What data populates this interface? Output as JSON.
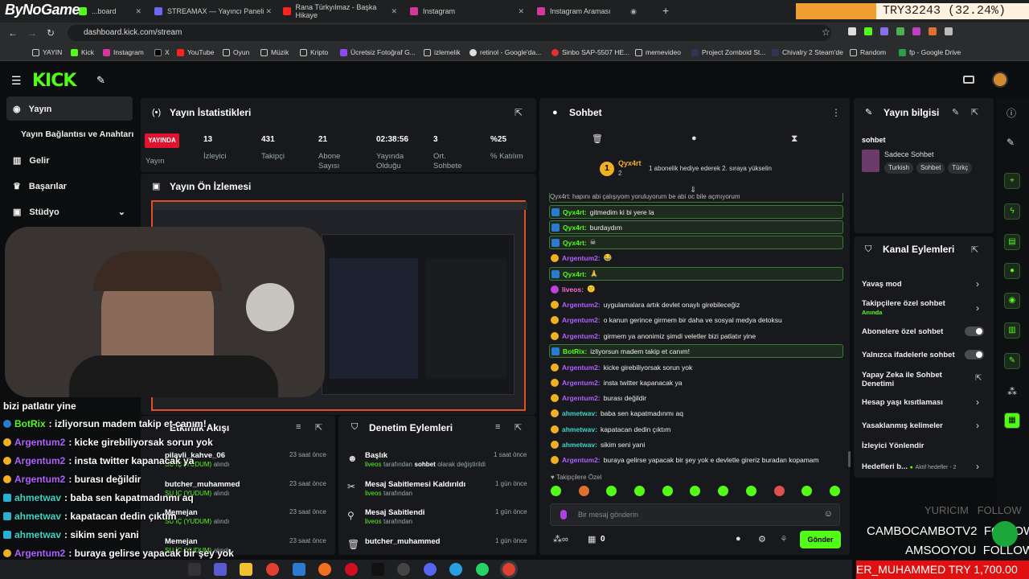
{
  "browser": {
    "tabs": [
      {
        "title": "...board",
        "x": 0
      },
      {
        "title": "STREAMAX — Yayıncı Paneli"
      },
      {
        "title": "Rana Türkyılmaz - Başka Hikaye"
      },
      {
        "title": "Instagram"
      },
      {
        "title": "Instagram Araması"
      }
    ],
    "url": "dashboard.kick.com/stream",
    "bookmarks": [
      "YAYIN",
      "Kick",
      "Instagram",
      "X",
      "YouTube",
      "Oyun",
      "Müzik",
      "Kripto",
      "Ücretsiz Fotoğraf G...",
      "izlemelik",
      "retinol - Google'da...",
      "Sinbo SAP-5507 HE...",
      "memevideo",
      "Project Zomboid St...",
      "Chivalry 2 Steam'de",
      "Random",
      "fp - Google Drive"
    ]
  },
  "overlay": {
    "brand": "ByNoGame",
    "ticker_top": "TRY32243 (32.24%)",
    "ticker_bottom": "ER_MUHAMMED  TRY 1,700.00",
    "followers": [
      {
        "name": "YURICIM",
        "label": "FOLLOW"
      },
      {
        "name": "CAMBOCAMBOTV2",
        "label": "FOLLOW"
      },
      {
        "name": "AMSOOYOU",
        "label": "FOLLOW"
      }
    ],
    "chat": [
      {
        "user": "",
        "text": "bizi patlatır yine"
      },
      {
        "user": "BotRix",
        "text": ": izliyorsun madem takip et canım!",
        "color": "#53fc18"
      },
      {
        "user": "Argentum2",
        "text": ": kicke girebiliyorsak sorun yok",
        "color": "#b060ff"
      },
      {
        "user": "Argentum2",
        "text": ": insta twitter kapanacak ya",
        "color": "#b060ff"
      },
      {
        "user": "Argentum2",
        "text": ": burası değildir",
        "color": "#b060ff"
      },
      {
        "user": "ahmetwav",
        "text": ": baba sen kapatmadınmı aq",
        "color": "#3ad6c6"
      },
      {
        "user": "ahmetwav",
        "text": ": kapatacan dedin çıktım",
        "color": "#3ad6c6"
      },
      {
        "user": "ahmetwav",
        "text": ": sikim seni yani",
        "color": "#3ad6c6"
      },
      {
        "user": "Argentum2",
        "text": ": buraya gelirse yapacak bir şey yok",
        "color": "#b060ff"
      },
      {
        "user": "",
        "text": "e devletle gireriz buradan kopamam"
      }
    ]
  },
  "sidebar": {
    "items": [
      {
        "label": "Yayın",
        "icon": "broadcast-icon"
      },
      {
        "label": "Yayın Bağlantısı ve Anahtarı",
        "icon": ""
      },
      {
        "label": "Gelir",
        "icon": "chart-icon"
      },
      {
        "label": "Başarılar",
        "icon": "trophy-icon"
      },
      {
        "label": "Stüdyo",
        "icon": "studio-icon"
      }
    ]
  },
  "stats": {
    "title": "Yayın İstatistikleri",
    "live": "YAYINDA",
    "live_sub": "Yayın",
    "items": [
      {
        "value": "13",
        "label": "İzleyici"
      },
      {
        "value": "431",
        "label": "Takipçi"
      },
      {
        "value": "21",
        "label": "Abone Sayısı"
      },
      {
        "value": "02:38:56",
        "label": "Yayında Olduğu"
      },
      {
        "value": "3",
        "label": "Ort. Sohbete"
      },
      {
        "value": "%25",
        "label": "% Katılım"
      }
    ]
  },
  "preview": {
    "title": "Yayın Ön İzlemesi"
  },
  "activity": {
    "title": "Etkinlik Akışı",
    "items": [
      {
        "name": "pilavli_kahve_06",
        "sub": "SU İÇ (YUDUM)",
        "sub2": "alındı",
        "time": "23 saat önce"
      },
      {
        "name": "butcher_muhammed",
        "sub": "SU İÇ (YUDUM)",
        "sub2": "alındı",
        "time": "23 saat önce"
      },
      {
        "name": "Memejan",
        "sub": "SU İÇ (YUDUM)",
        "sub2": "alındı",
        "time": "23 saat önce"
      },
      {
        "name": "Memejan",
        "sub": "SU İÇ (YUDUM)",
        "sub2": "alındı",
        "time": "23 saat önce"
      }
    ]
  },
  "moderation": {
    "title": "Denetim Eylemleri",
    "items": [
      {
        "title": "Başlık",
        "who": "liveos",
        "desc1": "tarafından",
        "desc2": "sohbet",
        "desc3": "olarak değiştirildi",
        "time": "1 saat önce"
      },
      {
        "title": "Mesaj Sabitlemesi Kaldırıldı",
        "who": "liveos",
        "desc1": "tarafından",
        "desc2": "",
        "desc3": "",
        "time": "1 gün önce"
      },
      {
        "title": "Mesaj Sabitlendi",
        "who": "liveos",
        "desc1": "tarafından",
        "desc2": "",
        "desc3": "",
        "time": "1 gün önce"
      },
      {
        "title": "butcher_muhammed",
        "who": "",
        "desc1": "",
        "desc2": "",
        "desc3": "",
        "time": "1 gün önce"
      }
    ]
  },
  "chat": {
    "title": "Sohbet",
    "gifter_name": "Qyx4rt",
    "gifter_count": "2",
    "gift_text": "1 abonelik hediye ederek 2. sıraya yükselin",
    "top_cut": "Qyx4rt: hapını abi çalışıyom yoruluyorum be abi oc bile açmıyorum",
    "messages": [
      {
        "user": "Qyx4rt:",
        "text": "gitmedim ki bi yere la",
        "color": "#53fc18",
        "hl": true
      },
      {
        "user": "Qyx4rt:",
        "text": "burdaydım",
        "color": "#53fc18",
        "hl": true
      },
      {
        "user": "Qyx4rt:",
        "text": "☠",
        "color": "#53fc18",
        "hl": true
      },
      {
        "user": "Argentum2:",
        "text": "😂",
        "color": "#b060ff",
        "hl": false
      },
      {
        "user": "Qyx4rt:",
        "text": "🙏",
        "color": "#53fc18",
        "hl": true
      },
      {
        "user": "liveos:",
        "text": "🙂",
        "color": "#ff6ad5",
        "hl": false
      },
      {
        "user": "Argentum2:",
        "text": "uygulamalara artık devlet onaylı girebileceğiz",
        "color": "#b060ff",
        "hl": false
      },
      {
        "user": "Argentum2:",
        "text": "o kanun gerince girmem bir daha ve sosyal medya detoksu",
        "color": "#b060ff",
        "hl": false
      },
      {
        "user": "Argentum2:",
        "text": "girmem ya anonimiz şimdi veletler bizi patlatır yine",
        "color": "#b060ff",
        "hl": false
      },
      {
        "user": "BotRix:",
        "text": "izliyorsun madem takip et canım!",
        "color": "#53fc18",
        "hl": true
      },
      {
        "user": "Argentum2:",
        "text": "kicke girebiliyorsak sorun yok",
        "color": "#b060ff",
        "hl": false
      },
      {
        "user": "Argentum2:",
        "text": "insta twitter kapanacak ya",
        "color": "#b060ff",
        "hl": false
      },
      {
        "user": "Argentum2:",
        "text": "burası değildir",
        "color": "#b060ff",
        "hl": false
      },
      {
        "user": "ahmetwav:",
        "text": "baba sen kapatmadınmı aq",
        "color": "#3ad6c6",
        "hl": false
      },
      {
        "user": "ahmetwav:",
        "text": "kapatacan dedin çıktım",
        "color": "#3ad6c6",
        "hl": false
      },
      {
        "user": "ahmetwav:",
        "text": "sikim seni yani",
        "color": "#3ad6c6",
        "hl": false
      },
      {
        "user": "Argentum2:",
        "text": "buraya gelirse yapacak bir şey yok e devletle gireriz buradan kopamam",
        "color": "#b060ff",
        "hl": false
      }
    ],
    "followers_only": "Takipçilere Özel",
    "input_placeholder": "Bir mesaj gönderin",
    "points": "0",
    "send": "Gönder"
  },
  "stream_info": {
    "title": "Yayın bilgisi",
    "stream_title": "sohbet",
    "category": "Sadece Sohbet",
    "tags": [
      "Turkish",
      "Sohbet",
      "Türkç"
    ]
  },
  "channel_actions": {
    "title": "Kanal Eylemleri",
    "items": [
      {
        "label": "Yavaş mod",
        "sub": "",
        "control": "chevron"
      },
      {
        "label": "Takipçilere özel sohbet",
        "sub": "Anında",
        "control": "chevron"
      },
      {
        "label": "Abonelere özel sohbet",
        "sub": "",
        "control": "toggle"
      },
      {
        "label": "Yalnızca ifadelerle sohbet",
        "sub": "",
        "control": "toggle"
      },
      {
        "label": "Yapay Zeka ile Sohbet Denetimi",
        "sub": "",
        "control": "external"
      },
      {
        "label": "Hesap yaşı kısıtlaması",
        "sub": "",
        "control": "chevron"
      },
      {
        "label": "Yasaklanmış kelimeler",
        "sub": "",
        "control": "chevron"
      },
      {
        "label": "İzleyici Yönlendir",
        "sub": "",
        "control": ""
      },
      {
        "label": "Hedefleri b...",
        "sub": "Aktif hedefler - 2",
        "control": "chevron"
      }
    ]
  }
}
